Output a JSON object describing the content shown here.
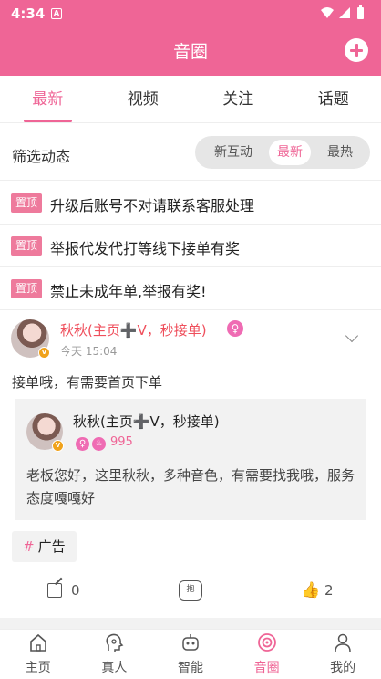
{
  "status_bar": {
    "time": "4:34",
    "notif_glyph": "A"
  },
  "header": {
    "title": "音圈",
    "add_icon": "plus-circle-icon"
  },
  "tabs": [
    {
      "label": "最新",
      "active": true
    },
    {
      "label": "视频",
      "active": false
    },
    {
      "label": "关注",
      "active": false
    },
    {
      "label": "话题",
      "active": false
    }
  ],
  "filter": {
    "label": "筛选动态",
    "options": [
      "新互动",
      "最新",
      "最热"
    ],
    "selected": "最新"
  },
  "pinned": [
    {
      "tag": "置顶",
      "text": "升级后账号不对请联系客服处理"
    },
    {
      "tag": "置顶",
      "text": "举报代发代打等线下接单有奖"
    },
    {
      "tag": "置顶",
      "text": "禁止未成年单,举报有奖!"
    }
  ],
  "post": {
    "author": "秋秋(主页➕V，秒接单)",
    "gender_icon": "female-icon",
    "time": "今天 15:04",
    "badge": "V",
    "content": "接单哦，有需要首页下单",
    "quote": {
      "name": "秋秋(主页➕V，秒接单)",
      "heat": "995",
      "text": "老板您好，这里秋秋，多种音色，有需要找我哦，服务态度嘎嘎好"
    },
    "hashtag_symbol": "#",
    "hashtag": "广告",
    "actions": {
      "share_count": "0",
      "like_count": "2",
      "robot_label": "抱"
    }
  },
  "bottom_nav": [
    {
      "label": "主页",
      "icon": "home-icon",
      "active": false
    },
    {
      "label": "真人",
      "icon": "voice-head-icon",
      "active": false
    },
    {
      "label": "智能",
      "icon": "robot-icon",
      "active": false
    },
    {
      "label": "音圈",
      "icon": "circle-target-icon",
      "active": true
    },
    {
      "label": "我的",
      "icon": "person-icon",
      "active": false
    }
  ],
  "colors": {
    "brand": "#ef6596",
    "name_red": "#ef4f5c",
    "pin_tag": "#ee7a9c"
  }
}
